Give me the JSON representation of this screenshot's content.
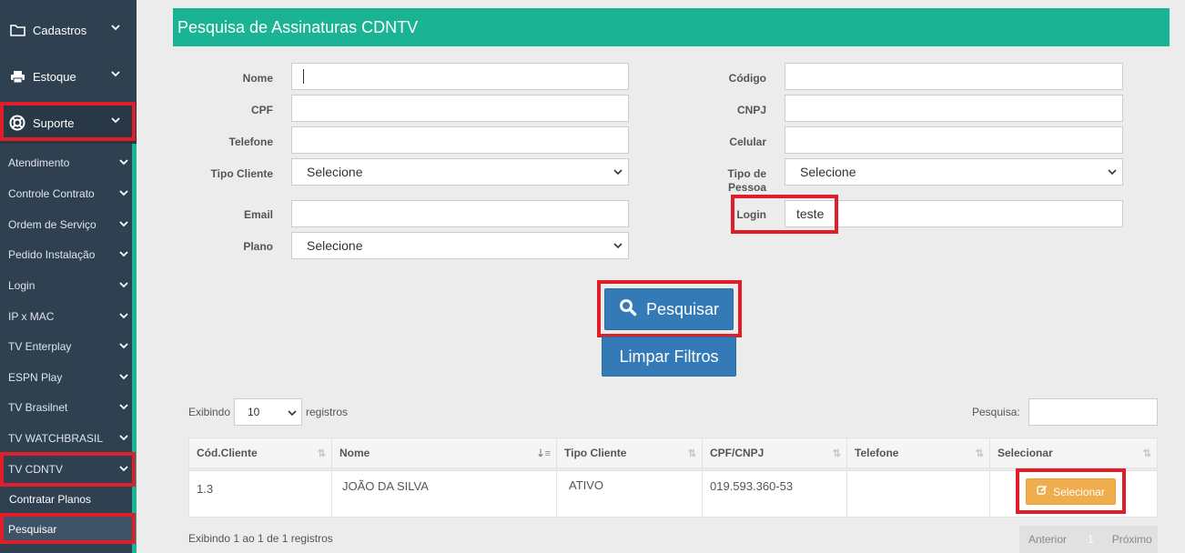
{
  "sidebar": {
    "top_items": [
      {
        "label": "Cadastros",
        "icon": "folder-icon"
      },
      {
        "label": "Estoque",
        "icon": "printer-icon"
      },
      {
        "label": "Suporte",
        "icon": "lifebuoy-icon"
      }
    ],
    "sub_items": [
      "Atendimento",
      "Controle Contrato",
      "Ordem de Serviço",
      "Pedido Instalação",
      "Login",
      "IP x MAC",
      "TV Enterplay",
      "ESPN Play",
      "TV Brasilnet",
      "TV WATCHBRASIL",
      "TV CDNTV"
    ],
    "leaf_items": [
      "Contratar Planos",
      "Pesquisar"
    ]
  },
  "header": {
    "title": "Pesquisa de Assinaturas CDNTV"
  },
  "form": {
    "nome": {
      "label": "Nome",
      "value": ""
    },
    "cpf": {
      "label": "CPF",
      "value": ""
    },
    "telefone": {
      "label": "Telefone",
      "value": ""
    },
    "tipo_cliente": {
      "label": "Tipo Cliente",
      "value": "Selecione"
    },
    "email": {
      "label": "Email",
      "value": ""
    },
    "plano": {
      "label": "Plano",
      "value": "Selecione"
    },
    "codigo": {
      "label": "Código",
      "value": ""
    },
    "cnpj": {
      "label": "CNPJ",
      "value": ""
    },
    "celular": {
      "label": "Celular",
      "value": ""
    },
    "tipo_pessoa": {
      "label_line1": "Tipo de",
      "label_line2": "Pessoa",
      "value": "Selecione"
    },
    "login": {
      "label": "Login",
      "value": "teste"
    }
  },
  "buttons": {
    "search": "Pesquisar",
    "clear": "Limpar Filtros"
  },
  "table_controls": {
    "show_prefix": "Exibindo",
    "page_size": "10",
    "show_suffix": "registros",
    "search_label": "Pesquisa:"
  },
  "table": {
    "columns": [
      "Cód.Cliente",
      "Nome",
      "Tipo Cliente",
      "CPF/CNPJ",
      "Telefone",
      "Selecionar"
    ],
    "rows": [
      {
        "codigo": "1.3",
        "nome": "JOÃO DA SILVA",
        "tipo": "ATIVO",
        "cpf_cnpj": "019.593.360-53",
        "telefone": "",
        "action": "Selecionar"
      }
    ]
  },
  "footer": {
    "info": "Exibindo 1 ao 1 de 1 registros",
    "prev": "Anterior",
    "page": "1",
    "next": "Próximo"
  },
  "colors": {
    "sidebar_bg": "#2f4050",
    "accent_green": "#1ab394",
    "primary_blue": "#337ab7",
    "warning_orange": "#f0ad4e",
    "highlight_red": "#e01e2a"
  }
}
